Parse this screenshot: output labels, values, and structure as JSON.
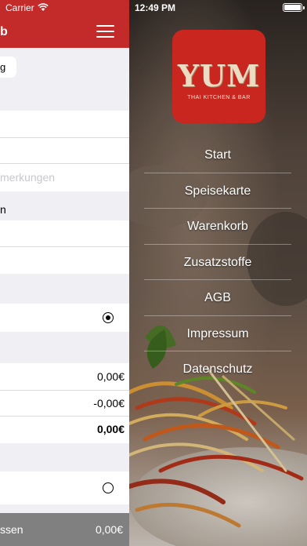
{
  "left_screen": {
    "status": {
      "carrier": "Carrier"
    },
    "nav": {
      "title": "b"
    },
    "pill_label": "g",
    "notes_placeholder": "merkungen",
    "section_text": "n",
    "rows": {
      "subtotal": "0,00€",
      "discount": "-0,00€",
      "total": "0,00€"
    },
    "radio_top_selected": true,
    "radio_bottom_selected": false,
    "bottom_bar": {
      "label": "ssen",
      "value": "0,00€"
    }
  },
  "right_screen": {
    "status": {
      "time": "12:49 PM"
    },
    "logo": {
      "title": "YUM",
      "subtitle": "THAI KITCHEN & BAR"
    },
    "menu": [
      {
        "label": "Start"
      },
      {
        "label": "Speisekarte"
      },
      {
        "label": "Warenkorb"
      },
      {
        "label": "Zusatzstoffe"
      },
      {
        "label": "AGB"
      },
      {
        "label": "Impressum"
      },
      {
        "label": "Datenschutz"
      }
    ]
  },
  "colors": {
    "brand_red": "#c32a2a",
    "logo_red": "#c8261f",
    "bottom_bar_grey": "#808080"
  },
  "icons": [
    "wifi-icon",
    "hamburger-menu-icon",
    "battery-icon",
    "radio-selected-icon",
    "radio-unselected-icon"
  ]
}
